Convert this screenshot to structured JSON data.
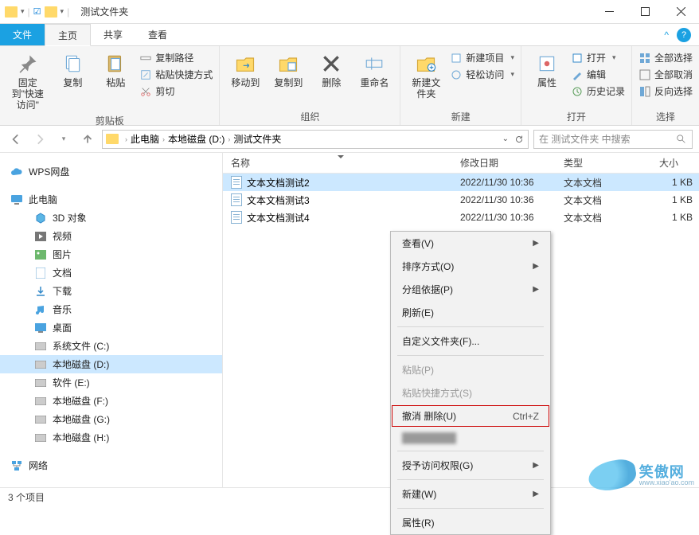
{
  "window": {
    "title": "测试文件夹"
  },
  "tabs": {
    "file": "文件",
    "home": "主页",
    "share": "共享",
    "view": "查看"
  },
  "ribbon": {
    "clipboard": {
      "pin": "固定到\"快速访问\"",
      "copy": "复制",
      "paste": "粘贴",
      "copy_path": "复制路径",
      "paste_shortcut": "粘贴快捷方式",
      "cut": "剪切",
      "label": "剪贴板"
    },
    "organize": {
      "move": "移动到",
      "copy_to": "复制到",
      "delete": "删除",
      "rename": "重命名",
      "label": "组织"
    },
    "new": {
      "folder": "新建文件夹",
      "new_item": "新建项目",
      "easy_access": "轻松访问",
      "label": "新建"
    },
    "open": {
      "properties": "属性",
      "open": "打开",
      "edit": "编辑",
      "history": "历史记录",
      "label": "打开"
    },
    "select": {
      "all": "全部选择",
      "none": "全部取消",
      "invert": "反向选择",
      "label": "选择"
    }
  },
  "breadcrumb": {
    "this_pc": "此电脑",
    "drive": "本地磁盘 (D:)",
    "folder": "测试文件夹"
  },
  "search": {
    "placeholder": "在 测试文件夹 中搜索"
  },
  "tree": {
    "wps": "WPS网盘",
    "this_pc": "此电脑",
    "obj3d": "3D 对象",
    "videos": "视频",
    "pictures": "图片",
    "documents": "文档",
    "downloads": "下载",
    "music": "音乐",
    "desktop": "桌面",
    "sys_c": "系统文件 (C:)",
    "disk_d": "本地磁盘 (D:)",
    "soft_e": "软件 (E:)",
    "disk_f": "本地磁盘 (F:)",
    "disk_g": "本地磁盘 (G:)",
    "disk_h": "本地磁盘 (H:)",
    "network": "网络"
  },
  "columns": {
    "name": "名称",
    "date": "修改日期",
    "type": "类型",
    "size": "大小"
  },
  "files": [
    {
      "name": "文本文档测试2",
      "date": "2022/11/30 10:36",
      "type": "文本文档",
      "size": "1 KB"
    },
    {
      "name": "文本文档测试3",
      "date": "2022/11/30 10:36",
      "type": "文本文档",
      "size": "1 KB"
    },
    {
      "name": "文本文档测试4",
      "date": "2022/11/30 10:36",
      "type": "文本文档",
      "size": "1 KB"
    }
  ],
  "context_menu": {
    "view": "查看(V)",
    "sort": "排序方式(O)",
    "group": "分组依据(P)",
    "refresh": "刷新(E)",
    "customize": "自定义文件夹(F)...",
    "paste": "粘贴(P)",
    "paste_shortcut": "粘贴快捷方式(S)",
    "undo_delete": "撤消 删除(U)",
    "undo_shortcut": "Ctrl+Z",
    "grant_access": "授予访问权限(G)",
    "new": "新建(W)",
    "properties": "属性(R)"
  },
  "status": {
    "items": "3 个项目"
  },
  "watermark": {
    "cn": "笑傲网",
    "en": "www.xiao'ao.com"
  }
}
